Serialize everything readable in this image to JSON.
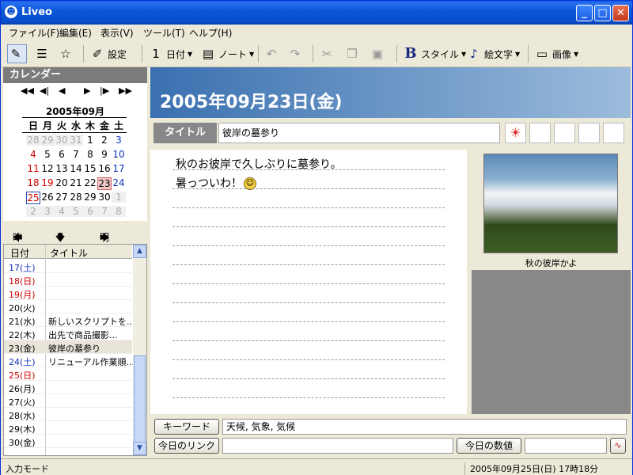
{
  "window": {
    "title": "Liveo"
  },
  "menu": [
    "ファイル(F)",
    "編集(E)",
    "表示(V)",
    "ツール(T)",
    "ヘルプ(H)"
  ],
  "toolbar": {
    "settings": "設定",
    "date": "日付",
    "note": "ノート",
    "style": "スタイル",
    "emoji": "絵文字",
    "image": "画像"
  },
  "calendar": {
    "header": "カレンダー",
    "month": "2005年09月",
    "dow": [
      "日",
      "月",
      "火",
      "水",
      "木",
      "金",
      "土"
    ],
    "weeks": [
      [
        "28",
        "29",
        "30",
        "31",
        "1",
        "2",
        "3"
      ],
      [
        "4",
        "5",
        "6",
        "7",
        "8",
        "9",
        "10"
      ],
      [
        "11",
        "12",
        "13",
        "14",
        "15",
        "16",
        "17"
      ],
      [
        "18",
        "19",
        "20",
        "21",
        "22",
        "23",
        "24"
      ],
      [
        "25",
        "26",
        "27",
        "28",
        "29",
        "30",
        "1"
      ],
      [
        "2",
        "3",
        "4",
        "5",
        "6",
        "7",
        "8"
      ]
    ],
    "selected": "23",
    "today": "25"
  },
  "daynav": {
    "prev": "昨日",
    "today": "今日",
    "next": "明日"
  },
  "list": {
    "col_date": "日付",
    "col_title": "タイトル",
    "rows": [
      {
        "date": "17(土)",
        "title": ""
      },
      {
        "date": "18(日)",
        "title": ""
      },
      {
        "date": "19(月)",
        "title": ""
      },
      {
        "date": "20(火)",
        "title": ""
      },
      {
        "date": "21(水)",
        "title": "新しいスクリプトを..."
      },
      {
        "date": "22(木)",
        "title": "出先で商品撮影..."
      },
      {
        "date": "23(金)",
        "title": "彼岸の墓参り"
      },
      {
        "date": "24(土)",
        "title": "リニューアル作業順..."
      },
      {
        "date": "25(日)",
        "title": ""
      },
      {
        "date": "26(月)",
        "title": ""
      },
      {
        "date": "27(火)",
        "title": ""
      },
      {
        "date": "28(水)",
        "title": ""
      },
      {
        "date": "29(木)",
        "title": ""
      },
      {
        "date": "30(金)",
        "title": ""
      }
    ]
  },
  "entry": {
    "date": "2005年09月23日(金)",
    "title_label": "タイトル",
    "title": "彼岸の墓参り",
    "lines": [
      "秋のお彼岸で久しぶりに墓参り。",
      "暑っついわ！"
    ],
    "photo_caption": "秋の彼岸かよ",
    "keyword_label": "キーワード",
    "keywords": "天候, 気象, 気候",
    "link_label": "今日のリンク",
    "link_value": "",
    "number_label": "今日の数値",
    "number_value": ""
  },
  "status": {
    "mode": "入力モード",
    "datetime": "2005年09月25日(日) 17時18分"
  },
  "colors": {
    "sunday": "#d00000",
    "saturday": "#1030c0",
    "holiday": "#d00000"
  }
}
